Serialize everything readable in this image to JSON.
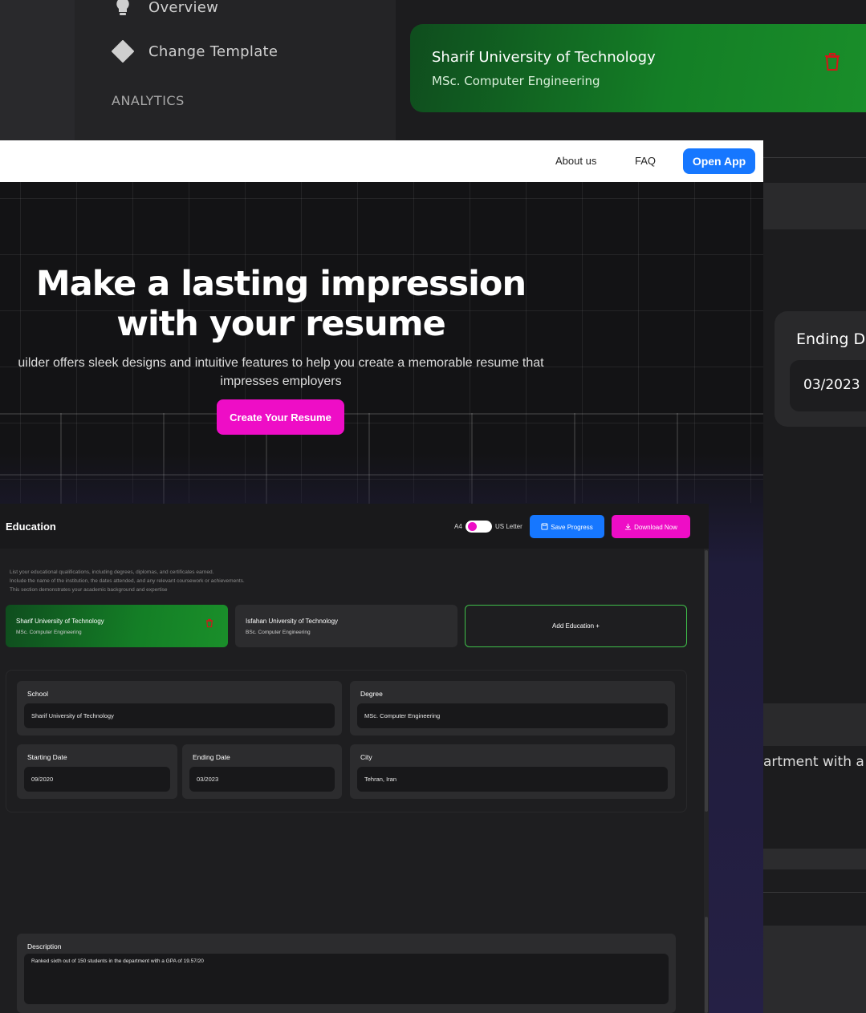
{
  "back": {
    "sidebar": {
      "items": [
        {
          "label": "Overview",
          "icon": "lightbulb-icon"
        },
        {
          "label": "Change Template",
          "icon": "diamond-icon"
        }
      ],
      "section_heading": "ANALYTICS"
    },
    "education_card": {
      "school": "Sharif University of Technology",
      "degree": "MSc. Computer Engineering",
      "icon": "trash-icon"
    },
    "ending_date": {
      "label": "Ending D",
      "value": "03/2023"
    },
    "description_fragment": "artment with a"
  },
  "landing": {
    "nav": {
      "about": "About us",
      "faq": "FAQ",
      "open_app": "Open App"
    },
    "hero": {
      "line1": "Make a lasting impression",
      "line2": "with your resume"
    },
    "subtitle_line1": "uilder offers sleek designs and intuitive features to help you create a memorable resume that",
    "subtitle_line2": "impresses employers",
    "cta": "Create Your Resume"
  },
  "editor": {
    "title": "Education",
    "page_size": {
      "left": "A4",
      "right": "US Letter"
    },
    "save_label": "Save Progress",
    "download_label": "Download Now",
    "intro": [
      "List your educational qualifications, including degrees, diplomas, and certificates earned.",
      "Include the name of the institution, the dates attended, and any relevant coursework or achievements.",
      "This section demonstrates your academic background and expertise"
    ],
    "cards": [
      {
        "school": "Sharif University of Technology",
        "degree": "MSc. Computer Engineering"
      },
      {
        "school": "Isfahan University of Technology",
        "degree": "BSc. Computer Engineering"
      }
    ],
    "add_label": "Add Education +",
    "form": {
      "school": {
        "label": "School",
        "value": "Sharif University of Technology"
      },
      "degree": {
        "label": "Degree",
        "value": "MSc. Computer Engineering"
      },
      "start": {
        "label": "Starting Date",
        "value": "09/2020"
      },
      "end": {
        "label": "Ending Date",
        "value": "03/2023"
      },
      "city": {
        "label": "City",
        "value": "Tehran, Iran"
      },
      "description": {
        "label": "Description",
        "value": "Ranked sixth out of 150 students in the department with a GPA of 19.57/20"
      }
    }
  },
  "colors": {
    "accent_pink": "#ee0dc6",
    "accent_blue": "#1677ff",
    "card_green": "#147f26",
    "delete_red": "#d01818"
  }
}
